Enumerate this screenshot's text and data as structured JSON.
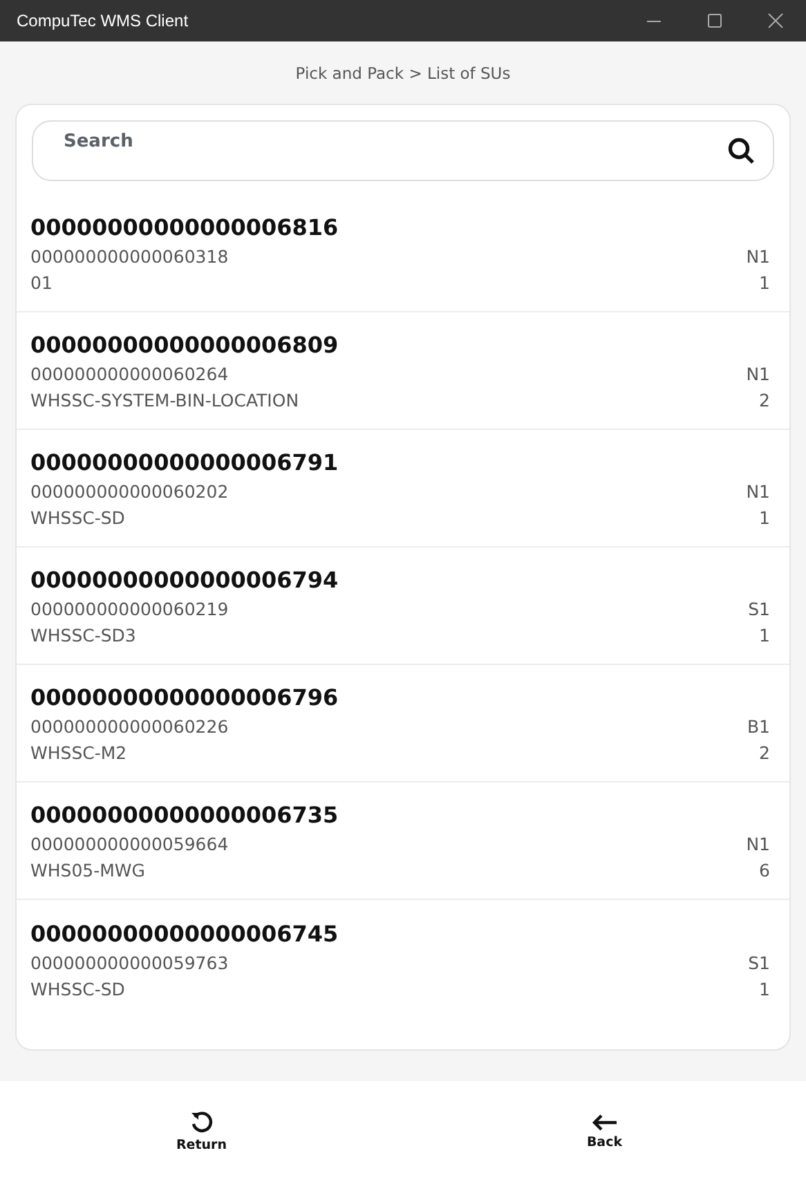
{
  "window": {
    "title": "CompuTec WMS Client"
  },
  "breadcrumb": "Pick and Pack > List of SUs",
  "search": {
    "placeholder": "Search"
  },
  "items": [
    {
      "title": "00000000000000006816",
      "code": "000000000000060318",
      "location": "01",
      "tag": "N1",
      "count": "1"
    },
    {
      "title": "00000000000000006809",
      "code": "000000000000060264",
      "location": "WHSSC-SYSTEM-BIN-LOCATION",
      "tag": "N1",
      "count": "2"
    },
    {
      "title": "00000000000000006791",
      "code": "000000000000060202",
      "location": "WHSSC-SD",
      "tag": "N1",
      "count": "1"
    },
    {
      "title": "00000000000000006794",
      "code": "000000000000060219",
      "location": "WHSSC-SD3",
      "tag": "S1",
      "count": "1"
    },
    {
      "title": "00000000000000006796",
      "code": "000000000000060226",
      "location": "WHSSC-M2",
      "tag": "B1",
      "count": "2"
    },
    {
      "title": "00000000000000006735",
      "code": "000000000000059664",
      "location": "WHS05-MWG",
      "tag": "N1",
      "count": "6"
    },
    {
      "title": "00000000000000006745",
      "code": "000000000000059763",
      "location": "WHSSC-SD",
      "tag": "S1",
      "count": "1"
    }
  ],
  "buttons": [
    {
      "kind": "return",
      "label": "Return"
    },
    {
      "kind": "back",
      "label": "Back"
    }
  ]
}
